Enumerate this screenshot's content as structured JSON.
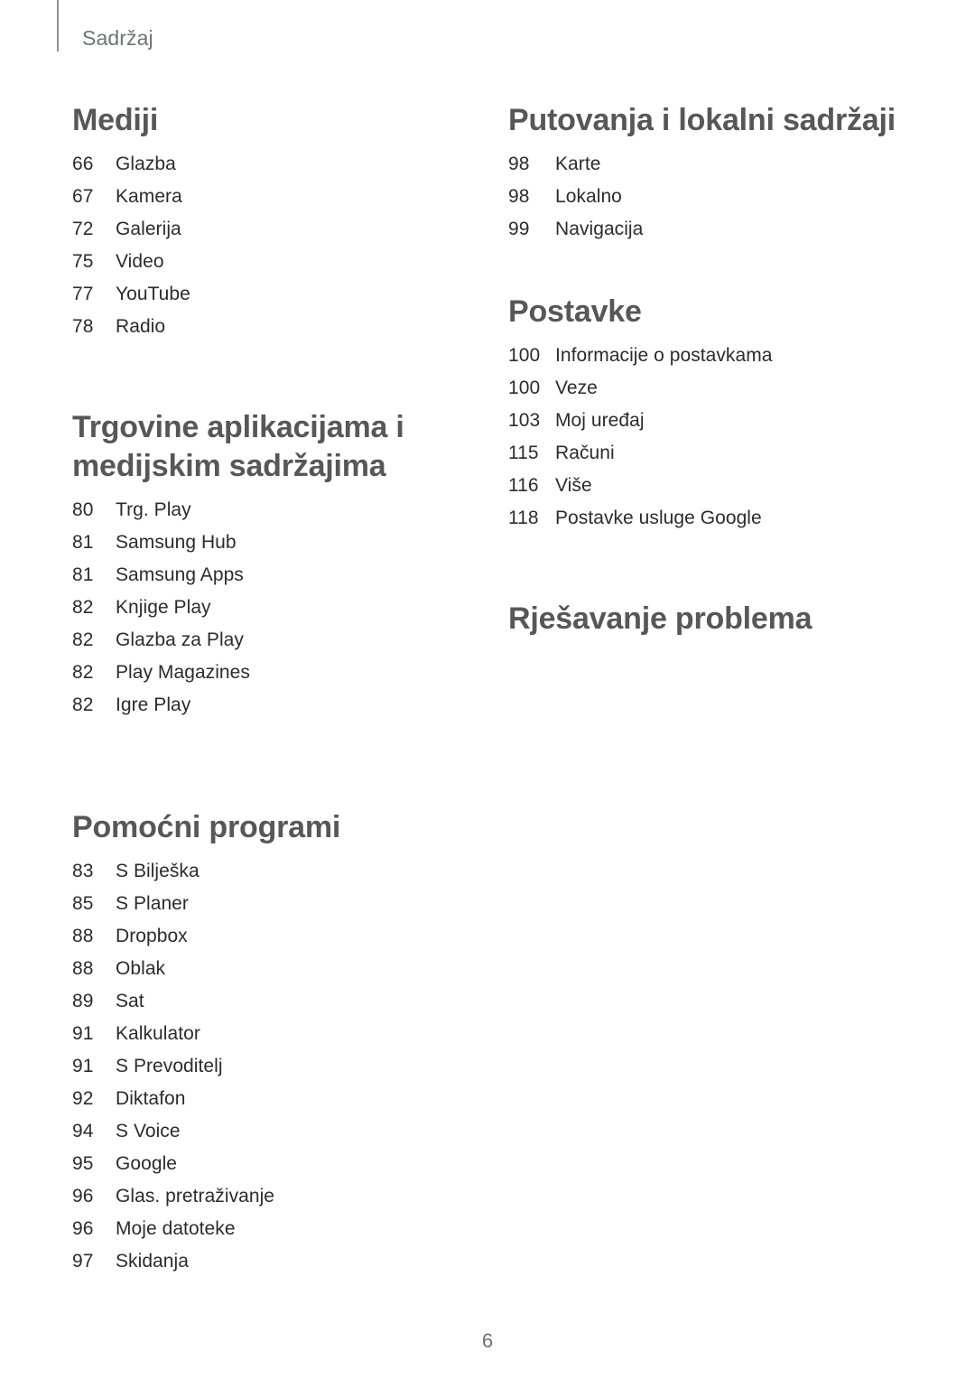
{
  "document": {
    "running_header": "Sadržaj",
    "page_number": "6",
    "colors": {
      "heading": "#575757",
      "entry_text": "#2c2c2c",
      "running_header": "#6d7477",
      "rule": "#8c9496",
      "folio": "#707070",
      "background": "#ffffff"
    }
  },
  "left_column": {
    "sections": [
      {
        "heading": "Mediji",
        "entries": [
          {
            "page": "66",
            "label": "Glazba"
          },
          {
            "page": "67",
            "label": "Kamera"
          },
          {
            "page": "72",
            "label": "Galerija"
          },
          {
            "page": "75",
            "label": "Video"
          },
          {
            "page": "77",
            "label": "YouTube"
          },
          {
            "page": "78",
            "label": "Radio"
          }
        ]
      },
      {
        "heading": "Trgovine aplikacijama i\nmedijskim sadržajima",
        "entries": [
          {
            "page": "80",
            "label": "Trg. Play"
          },
          {
            "page": "81",
            "label": "Samsung Hub"
          },
          {
            "page": "81",
            "label": "Samsung Apps"
          },
          {
            "page": "82",
            "label": "Knjige Play"
          },
          {
            "page": "82",
            "label": "Glazba za Play"
          },
          {
            "page": "82",
            "label": "Play Magazines"
          },
          {
            "page": "82",
            "label": "Igre Play"
          }
        ]
      },
      {
        "heading": "Pomoćni programi",
        "entries": [
          {
            "page": "83",
            "label": "S Bilješka"
          },
          {
            "page": "85",
            "label": "S Planer"
          },
          {
            "page": "88",
            "label": "Dropbox"
          },
          {
            "page": "88",
            "label": "Oblak"
          },
          {
            "page": "89",
            "label": "Sat"
          },
          {
            "page": "91",
            "label": "Kalkulator"
          },
          {
            "page": "91",
            "label": "S Prevoditelj"
          },
          {
            "page": "92",
            "label": "Diktafon"
          },
          {
            "page": "94",
            "label": "S Voice"
          },
          {
            "page": "95",
            "label": "Google"
          },
          {
            "page": "96",
            "label": "Glas. pretraživanje"
          },
          {
            "page": "96",
            "label": "Moje datoteke"
          },
          {
            "page": "97",
            "label": "Skidanja"
          }
        ]
      }
    ]
  },
  "right_column": {
    "sections": [
      {
        "heading": "Putovanja i lokalni sadržaji",
        "entries": [
          {
            "page": "98",
            "label": "Karte"
          },
          {
            "page": "98",
            "label": "Lokalno"
          },
          {
            "page": "99",
            "label": "Navigacija"
          }
        ]
      },
      {
        "heading": "Postavke",
        "entries": [
          {
            "page": "100",
            "label": "Informacije o postavkama"
          },
          {
            "page": "100",
            "label": "Veze"
          },
          {
            "page": "103",
            "label": "Moj uređaj"
          },
          {
            "page": "115",
            "label": "Računi"
          },
          {
            "page": "116",
            "label": "Više"
          },
          {
            "page": "118",
            "label": "Postavke usluge Google"
          }
        ]
      },
      {
        "heading": "Rješavanje problema",
        "entries": []
      }
    ]
  }
}
